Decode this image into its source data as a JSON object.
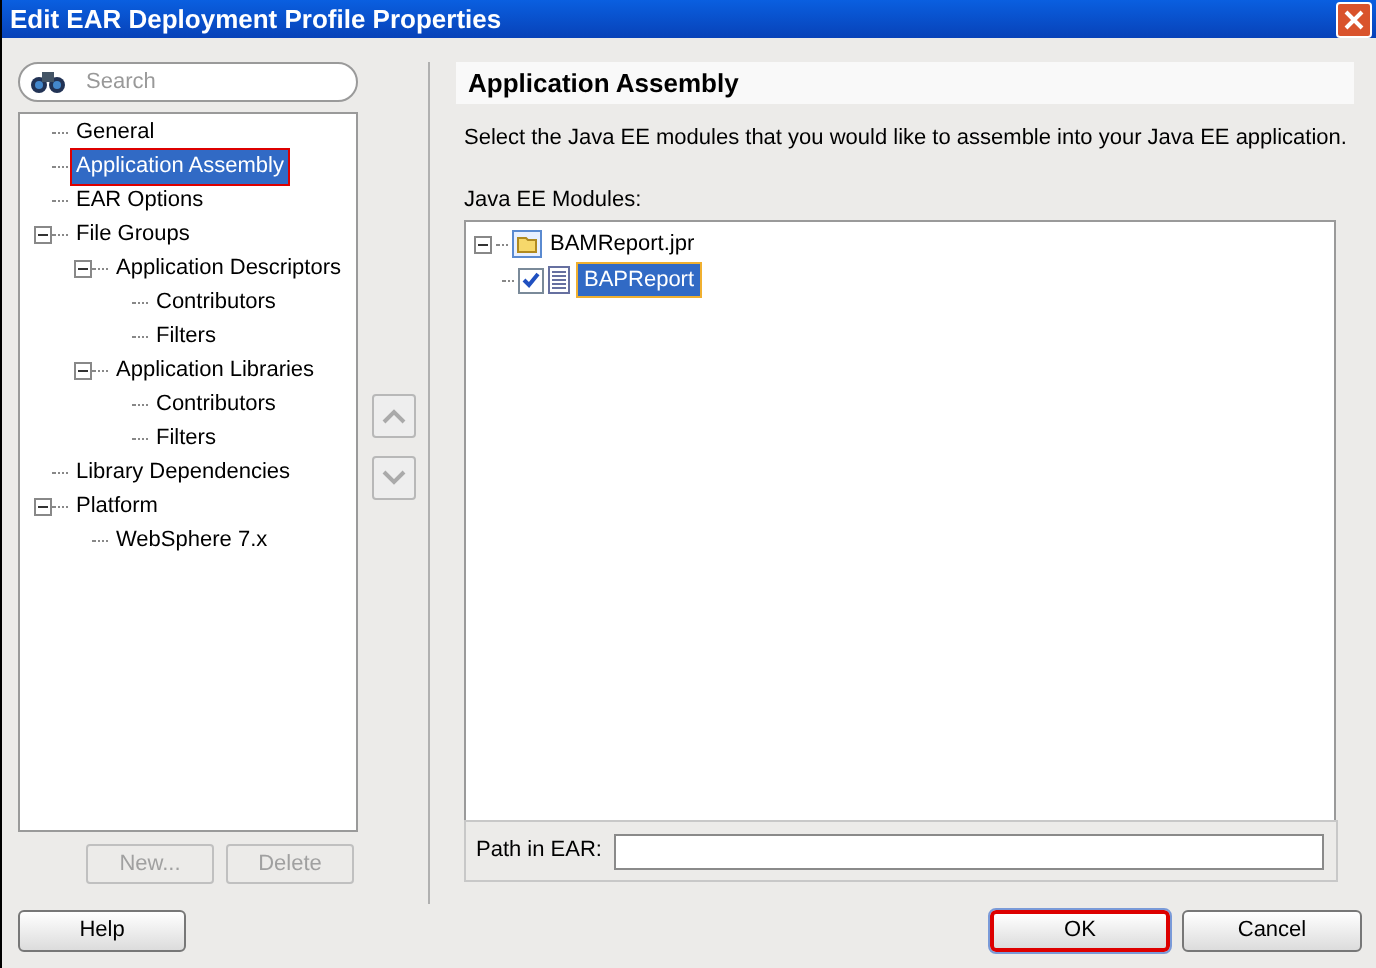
{
  "window": {
    "title": "Edit EAR Deployment Profile Properties"
  },
  "search": {
    "placeholder": "Search"
  },
  "nav_tree": [
    {
      "label": "General",
      "selected": false
    },
    {
      "label": "Application Assembly",
      "selected": true
    },
    {
      "label": "EAR Options",
      "selected": false
    },
    {
      "label": "File Groups",
      "selected": false,
      "expanded": true,
      "children": [
        {
          "label": "Application Descriptors",
          "selected": false,
          "expanded": true,
          "children": [
            {
              "label": "Contributors",
              "selected": false
            },
            {
              "label": "Filters",
              "selected": false
            }
          ]
        },
        {
          "label": "Application Libraries",
          "selected": false,
          "expanded": true,
          "children": [
            {
              "label": "Contributors",
              "selected": false
            },
            {
              "label": "Filters",
              "selected": false
            }
          ]
        }
      ]
    },
    {
      "label": "Library Dependencies",
      "selected": false
    },
    {
      "label": "Platform",
      "selected": false,
      "expanded": true,
      "children": [
        {
          "label": "WebSphere 7.x",
          "selected": false
        }
      ]
    }
  ],
  "nav_buttons": [
    {
      "label": "New...",
      "disabled": true
    },
    {
      "label": "Delete",
      "disabled": true
    }
  ],
  "panel": {
    "title": "Application Assembly",
    "description": "Select the Java EE modules that you would like to assemble into your Java EE application.",
    "modules_label": "Java EE Modules:",
    "modules": [
      {
        "label": "BAMReport.jpr",
        "expanded": true,
        "children": [
          {
            "label": "BAPReport",
            "checked": true,
            "selected": true
          }
        ]
      }
    ],
    "path_label": "Path in EAR:"
  },
  "buttons": [
    {
      "label": "Help",
      "default": false
    },
    {
      "label": "OK",
      "default": true
    },
    {
      "label": "Cancel",
      "default": false
    }
  ]
}
